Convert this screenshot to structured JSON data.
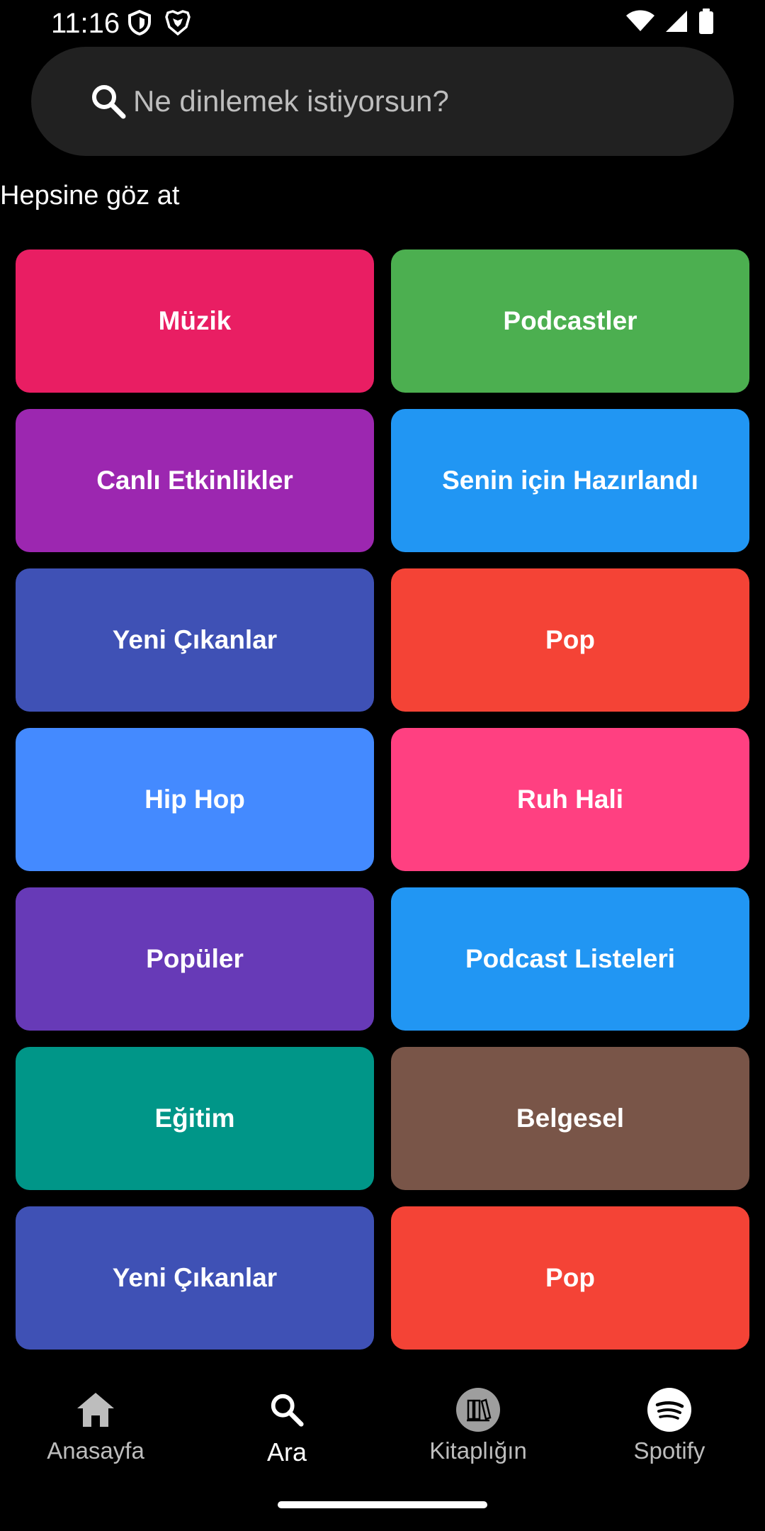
{
  "status_bar": {
    "time": "11:16",
    "left_icons": [
      "vpn-shield-icon",
      "brave-icon"
    ],
    "right_icons": [
      "wifi-icon",
      "cellular-icon",
      "battery-icon"
    ]
  },
  "search": {
    "placeholder": "Ne dinlemek istiyorsun?",
    "icon": "search-icon"
  },
  "section_title": "Hepsine göz at",
  "categories": [
    {
      "label": "Müzik",
      "color": "#E91E63"
    },
    {
      "label": "Podcastler",
      "color": "#4CAF50"
    },
    {
      "label": "Canlı Etkinlikler",
      "color": "#9C27B0"
    },
    {
      "label": "Senin için Hazırlandı",
      "color": "#2196F3"
    },
    {
      "label": "Yeni Çıkanlar",
      "color": "#3F51B5"
    },
    {
      "label": "Pop",
      "color": "#F44336"
    },
    {
      "label": "Hip Hop",
      "color": "#448AFF"
    },
    {
      "label": "Ruh Hali",
      "color": "#FF4081"
    },
    {
      "label": "Popüler",
      "color": "#673AB7"
    },
    {
      "label": "Podcast Listeleri",
      "color": "#2196F3"
    },
    {
      "label": "Eğitim",
      "color": "#009688"
    },
    {
      "label": "Belgesel",
      "color": "#795548"
    },
    {
      "label": "Yeni Çıkanlar",
      "color": "#3F51B5"
    },
    {
      "label": "Pop",
      "color": "#F44336"
    }
  ],
  "bottom_nav": {
    "items": [
      {
        "label": "Anasayfa",
        "icon": "home-icon",
        "active": false
      },
      {
        "label": "Ara",
        "icon": "search-icon",
        "active": true
      },
      {
        "label": "Kitaplığın",
        "icon": "library-icon",
        "active": false
      },
      {
        "label": "Spotify",
        "icon": "spotify-icon",
        "active": false
      }
    ]
  },
  "colors": {
    "background": "#000000",
    "search_bg": "#212121",
    "inactive_text": "#BDBDBD",
    "active_text": "#FFFFFF"
  }
}
